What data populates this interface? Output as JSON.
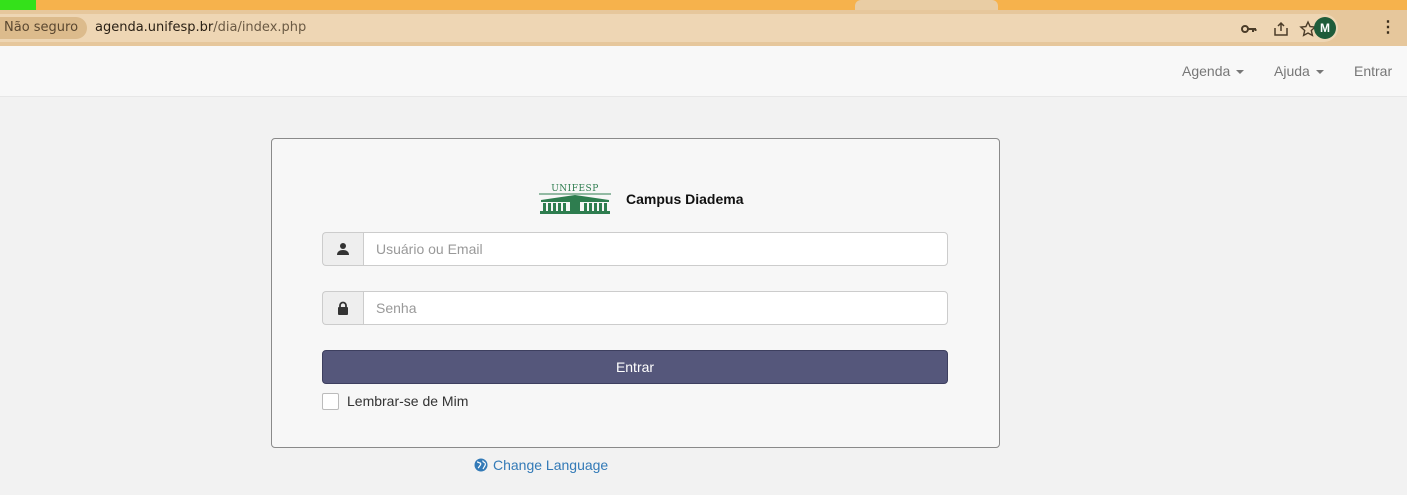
{
  "browser": {
    "security_chip": "Não seguro",
    "url_host": "agenda.unifesp.br",
    "url_path": "/dia/index.php",
    "profile_initial": "M",
    "icons": [
      "key-icon",
      "share-icon",
      "star-icon",
      "profile-avatar",
      "kebab-menu-icon"
    ]
  },
  "navbar": {
    "agenda": "Agenda",
    "ajuda": "Ajuda",
    "entrar": "Entrar"
  },
  "login": {
    "logo_text": "UNIFESP",
    "campus": "Campus Diadema",
    "username_placeholder": "Usuário ou Email",
    "password_placeholder": "Senha",
    "submit_label": "Entrar",
    "remember_label": "Lembrar-se de Mim",
    "remember_checked": false
  },
  "footer": {
    "change_language": "Change Language"
  },
  "colors": {
    "tab_strip": "#f6b24c",
    "address_bar": "#e6c79c",
    "button": "#55577b",
    "link": "#337ab7",
    "logo_green": "#2e7d4f"
  }
}
